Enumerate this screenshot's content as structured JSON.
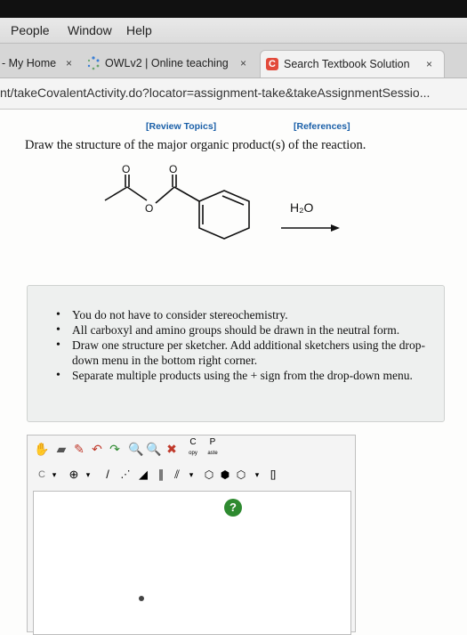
{
  "menu": {
    "items": [
      "People",
      "Window",
      "Help"
    ]
  },
  "tabs": [
    {
      "label": "- My Home",
      "close": "×"
    },
    {
      "label": "OWLv2 | Online teaching",
      "close": "×"
    },
    {
      "label": "Search Textbook Solution",
      "close": "×",
      "badge": "C"
    }
  ],
  "address_bar": {
    "url": "nt/takeCovalentActivity.do?locator=assignment-take&takeAssignmentSessio..."
  },
  "links": {
    "review": "[Review Topics]",
    "references": "[References]"
  },
  "question": "Draw the structure of the major organic product(s) of the reaction.",
  "reaction": {
    "carbonyl_o_1": "O",
    "carbonyl_o_2": "O",
    "bridge_o": "O",
    "reagent": "H₂O"
  },
  "instructions": [
    "You do not have to consider stereochemistry.",
    "All carboxyl and amino groups should be drawn in the neutral form.",
    "Draw one structure per sketcher. Add additional sketchers using the drop-down menu in the bottom right corner.",
    "Separate multiple products using the + sign from the drop-down menu."
  ],
  "sketcher": {
    "copy_label": "C",
    "copy_sub": "opy",
    "paste_label": "P",
    "paste_sub": "aste",
    "c_button": "C",
    "plus_button": "⊕",
    "help": "?"
  }
}
